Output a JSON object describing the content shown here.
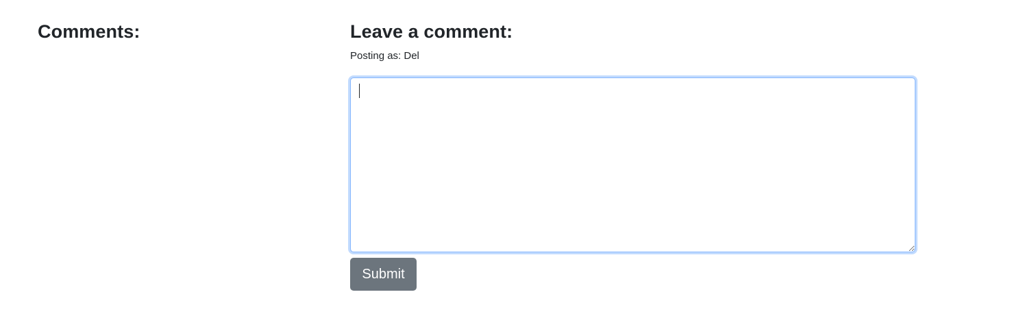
{
  "comments": {
    "heading": "Comments:"
  },
  "form": {
    "heading": "Leave a comment:",
    "posting_as": "Posting as: Del",
    "textarea_value": "",
    "submit_label": "Submit"
  },
  "colors": {
    "focus_border": "#86b7fe",
    "button_bg": "#6c757d",
    "text": "#212529"
  }
}
